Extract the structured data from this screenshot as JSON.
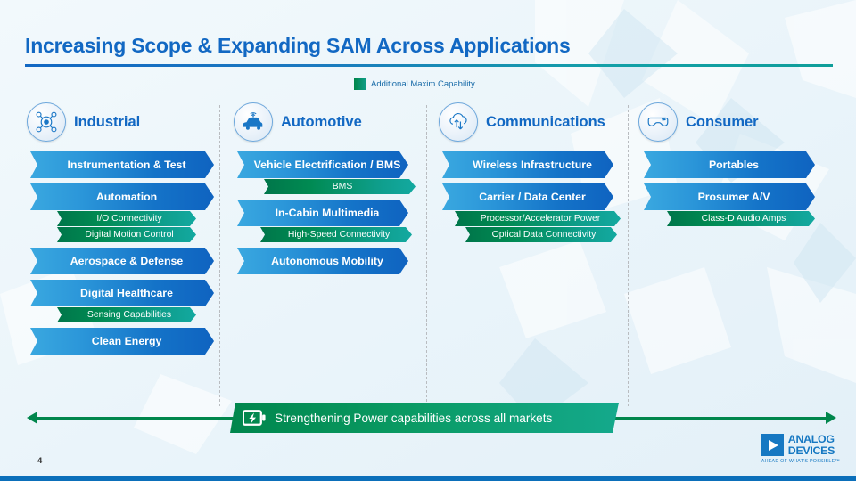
{
  "title": "Increasing Scope & Expanding SAM Across Applications",
  "legend": {
    "label": "Additional Maxim Capability",
    "swatch_color": "#00854a"
  },
  "colors": {
    "title_blue": "#1268c3",
    "bar_blue_light": "#3aa8e0",
    "bar_blue_dark": "#0f63c0",
    "green_dark": "#00764a",
    "green_teal": "#13a9a0",
    "background": "#eaf4fa",
    "bottom_bar": "#0b6fba"
  },
  "columns": [
    {
      "id": "industrial",
      "title": "Industrial",
      "icon": "industrial-network-icon",
      "items": [
        {
          "label": "Instrumentation & Test",
          "subs": []
        },
        {
          "label": "Automation",
          "subs": [
            "I/O Connectivity",
            "Digital Motion Control"
          ]
        },
        {
          "label": "Aerospace & Defense",
          "subs": []
        },
        {
          "label": "Digital Healthcare",
          "subs": [
            "Sensing Capabilities"
          ]
        },
        {
          "label": "Clean Energy",
          "subs": []
        }
      ]
    },
    {
      "id": "automotive",
      "title": "Automotive",
      "icon": "connected-car-icon",
      "items": [
        {
          "label": "Vehicle Electrification / BMS",
          "subs": [
            "BMS"
          ]
        },
        {
          "label": "In-Cabin Multimedia",
          "subs": [
            "High-Speed Connectivity"
          ]
        },
        {
          "label": "Autonomous Mobility",
          "subs": []
        }
      ]
    },
    {
      "id": "communications",
      "title": "Communications",
      "icon": "cloud-transfer-icon",
      "items": [
        {
          "label": "Wireless Infrastructure",
          "subs": []
        },
        {
          "label": "Carrier / Data Center",
          "subs": [
            "Processor/Accelerator Power",
            "Optical Data Connectivity"
          ]
        }
      ]
    },
    {
      "id": "consumer",
      "title": "Consumer",
      "icon": "vr-headset-icon",
      "items": [
        {
          "label": "Portables",
          "subs": []
        },
        {
          "label": "Prosumer A/V",
          "subs": [
            "Class-D Audio Amps"
          ]
        }
      ]
    }
  ],
  "banner": {
    "text": "Strengthening Power capabilities across all markets",
    "icon": "battery-bolt-icon"
  },
  "footer": {
    "page_number": "4",
    "logo_line1": "ANALOG",
    "logo_line2": "DEVICES",
    "logo_tagline": "AHEAD OF WHAT'S POSSIBLE™"
  }
}
